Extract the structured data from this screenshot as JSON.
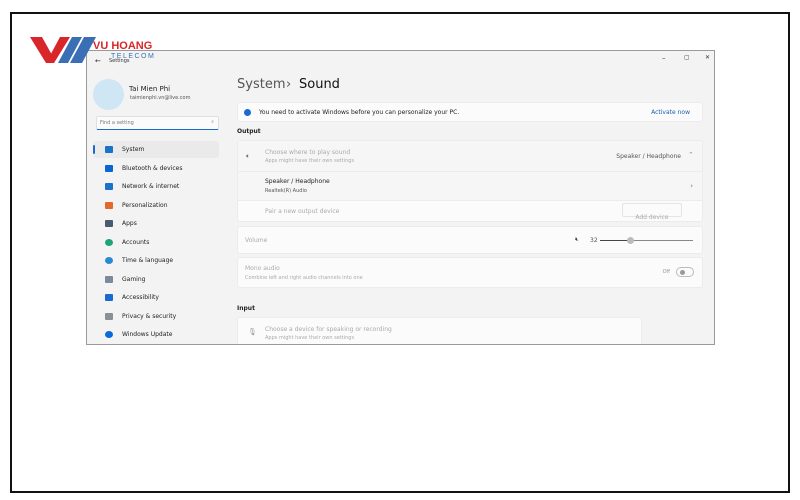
{
  "logo": {
    "brand": "VU HOANG",
    "sub": "TELECOM"
  },
  "window": {
    "app_title": "Settings",
    "minimize": "–",
    "maximize": "▢",
    "close": "✕"
  },
  "profile": {
    "name": "Tai Mien Phi",
    "email": "taimienphi.vn@live.com"
  },
  "search": {
    "placeholder": "Find a setting"
  },
  "sidebar": {
    "items": [
      {
        "label": "System",
        "icon": "monitor-icon",
        "color": "#1a73c8",
        "selected": true
      },
      {
        "label": "Bluetooth & devices",
        "icon": "bluetooth-icon",
        "color": "#0a64d6"
      },
      {
        "label": "Network & internet",
        "icon": "wifi-icon",
        "color": "#1a73c8"
      },
      {
        "label": "Personalization",
        "icon": "brush-icon",
        "color": "#e06a2a"
      },
      {
        "label": "Apps",
        "icon": "apps-icon",
        "color": "#4a5a70"
      },
      {
        "label": "Accounts",
        "icon": "person-icon",
        "color": "#1ea37a"
      },
      {
        "label": "Time & language",
        "icon": "globe-clock-icon",
        "color": "#2a8ad0"
      },
      {
        "label": "Gaming",
        "icon": "gamepad-icon",
        "color": "#7a8a9a"
      },
      {
        "label": "Accessibility",
        "icon": "accessibility-icon",
        "color": "#1a6ad0"
      },
      {
        "label": "Privacy & security",
        "icon": "shield-icon",
        "color": "#8a8f98"
      },
      {
        "label": "Windows Update",
        "icon": "update-icon",
        "color": "#0a6ad6"
      }
    ]
  },
  "breadcrumb": {
    "parent": "System",
    "sep": "›",
    "current": "Sound"
  },
  "banner": {
    "text": "You need to activate Windows before you can personalize your PC.",
    "link": "Activate now"
  },
  "output": {
    "heading": "Output",
    "choose": {
      "title": "Choose where to play sound",
      "sub": "Apps might have their own settings",
      "value": "Speaker / Headphone"
    },
    "device": {
      "title": "Speaker / Headphone",
      "sub": "Realtek(R) Audio"
    },
    "pair": {
      "label": "Pair a new output device",
      "button": "Add device"
    },
    "volume": {
      "label": "Volume",
      "value": "32",
      "percent": 32
    },
    "mono": {
      "title": "Mono audio",
      "sub": "Combine left and right audio channels into one",
      "state": "Off"
    }
  },
  "input": {
    "heading": "Input",
    "choose": {
      "title": "Choose a device for speaking or recording",
      "sub": "Apps might have their own settings"
    }
  }
}
